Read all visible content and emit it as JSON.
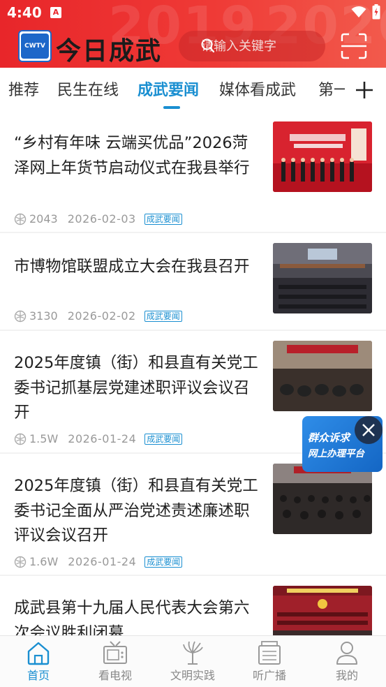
{
  "status_bar": {
    "time": "4:40",
    "notification_icon_letter": "A"
  },
  "app": {
    "title": "今日成武",
    "logo_text": "CWTV"
  },
  "header_decoration": {
    "year_left": "2019",
    "year_right": "2026"
  },
  "search": {
    "placeholder": "请输入关键字"
  },
  "tabs": [
    {
      "label": "推荐"
    },
    {
      "label": "民生在线"
    },
    {
      "label": "成武要闻",
      "active": true
    },
    {
      "label": "媒体看成武"
    },
    {
      "label": "第一"
    }
  ],
  "articles": [
    {
      "title": "“乡村有年味  云端买优品”2026菏泽网上年货节启动仪式在我县举行",
      "views": "2043",
      "date": "2026-02-03",
      "tag": "成武要闻",
      "thumb": "red-stage-ceremony"
    },
    {
      "title": "市博物馆联盟成立大会在我县召开",
      "views": "3130",
      "date": "2026-02-02",
      "tag": "成武要闻",
      "thumb": "meeting-hall"
    },
    {
      "title": "2025年度镇（街）和县直有关党工委书记抓基层党建述职评议会议召开",
      "views": "1.5W",
      "date": "2026-01-24",
      "tag": "成武要闻",
      "thumb": "conference-room"
    },
    {
      "title": "2025年度镇（街）和县直有关党工委书记全面从严治党述责述廉述职评议会议召开",
      "views": "1.6W",
      "date": "2026-01-24",
      "tag": "成武要闻",
      "thumb": "conference-audience"
    },
    {
      "title": "成武县第十九届人民代表大会第六次会议胜利闭幕",
      "views": "",
      "date": "",
      "tag": "",
      "thumb": "congress-stage"
    }
  ],
  "floating_ad": {
    "line1": "群众诉求",
    "line2": "网上办理平台"
  },
  "bottom_nav": [
    {
      "label": "首页",
      "icon": "home-icon",
      "active": true
    },
    {
      "label": "看电视",
      "icon": "tv-icon"
    },
    {
      "label": "文明实践",
      "icon": "civilization-icon"
    },
    {
      "label": "听广播",
      "icon": "radio-icon"
    },
    {
      "label": "我的",
      "icon": "user-icon"
    }
  ],
  "colors": {
    "header_red": "#e8262a",
    "accent_blue": "#1a8fd1",
    "text": "#1f1f1f",
    "meta_gray": "#999999"
  }
}
